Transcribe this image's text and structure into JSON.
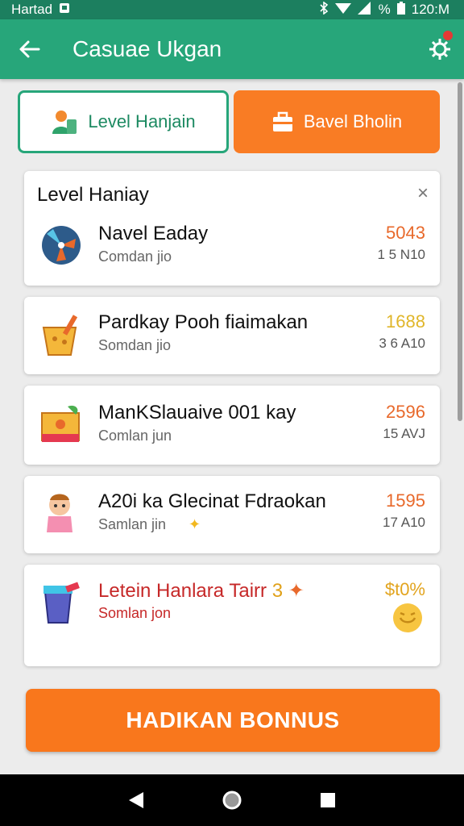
{
  "status": {
    "carrier": "Hartad",
    "time": "120:M",
    "battery": "%"
  },
  "app_bar": {
    "title": "Casuae Ukgan"
  },
  "tabs": [
    {
      "label": "Level Hanjain"
    },
    {
      "label": "Bavel Bholin"
    }
  ],
  "card_header": {
    "title": "Level Haniay",
    "close": "×"
  },
  "items": [
    {
      "title": "Navel Eaday",
      "sub": "Comdan jio",
      "score": "5043",
      "meta": "1 5 N10",
      "score_color": "#e8692b"
    },
    {
      "title": "Pardkay Pooh fiaimakan",
      "sub": "Somdan jio",
      "score": "1688",
      "meta": "3 6 A10",
      "score_color": "#e0b62a"
    },
    {
      "title": "ManKSlauaive  001 kay",
      "sub": "Comlan jun",
      "score": "2596",
      "meta": "15 AVJ",
      "score_color": "#e8692b"
    },
    {
      "title": "A20i ka Glecinat Fdraokan",
      "sub": "Samlan jin",
      "score": "1595",
      "meta": "17 A10",
      "score_color": "#e8692b"
    },
    {
      "title": "Letein Hanlara Tairr",
      "title_suffix": "3",
      "sub": "Somlan jon",
      "score": "$t0%",
      "meta": "",
      "score_color": "#e2a41e"
    }
  ],
  "bonus_button": {
    "label": "HADIKAN BONNUS"
  },
  "colors": {
    "primary": "#27a67a",
    "accent": "#f97c24",
    "status_bar": "#1c7f5f"
  }
}
